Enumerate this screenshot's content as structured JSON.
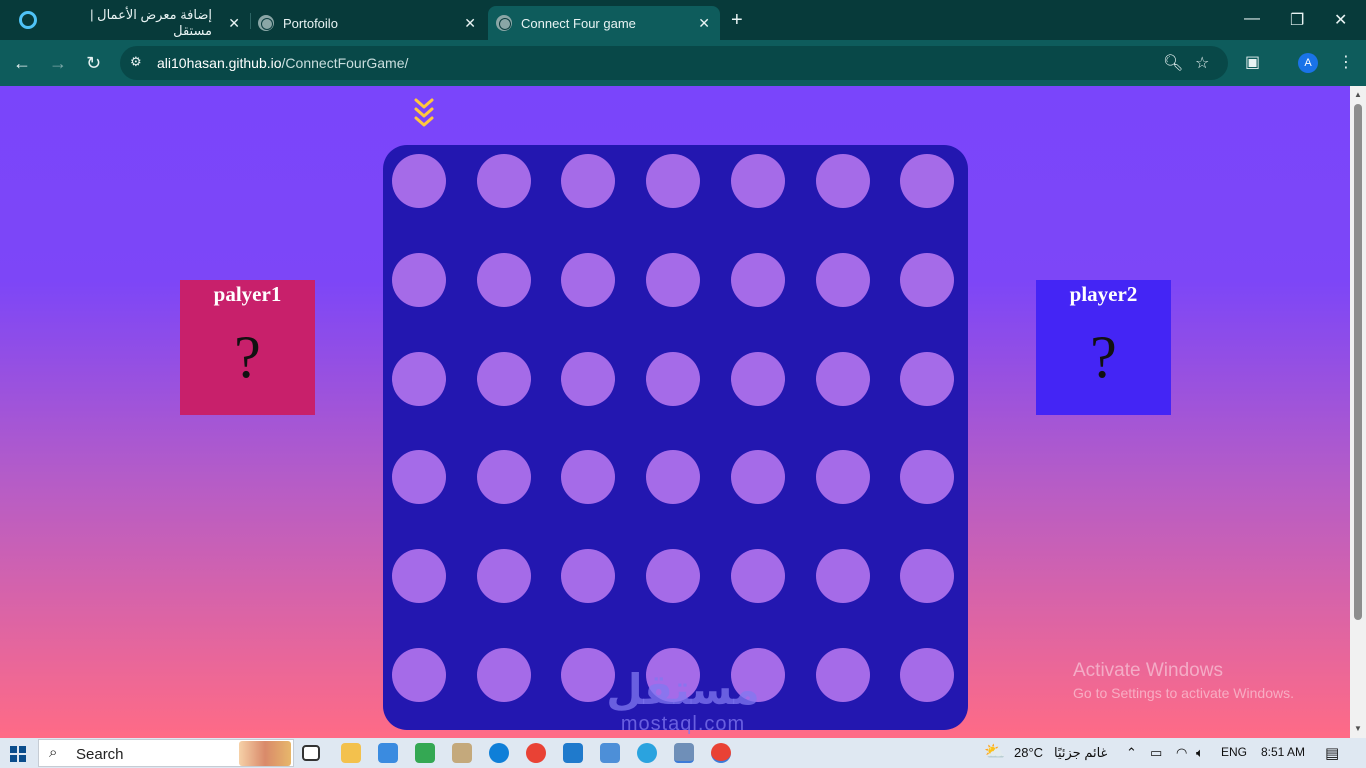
{
  "browser": {
    "tabs": [
      {
        "title": "إضافة معرض الأعمال | مستقل",
        "active": false
      },
      {
        "title": "Portofoilo",
        "active": false
      },
      {
        "title": "Connect Four game",
        "active": true
      }
    ],
    "new_tab_label": "+",
    "window_controls": {
      "minimize": "—",
      "restore": "❐",
      "close": "✕"
    },
    "address": {
      "host": "ali10hasan.github.io",
      "path": "/ConnectFourGame/"
    },
    "profile_initial": "A"
  },
  "game": {
    "rows": 6,
    "columns": 7,
    "board_color": "#2317b0",
    "empty_slot_color": "#a56be8",
    "drop_indicator_icon": "chevrons-down-icon",
    "player1": {
      "name": "palyer1",
      "value": "?",
      "color": "#c8206b"
    },
    "player2": {
      "name": "player2",
      "value": "?",
      "color": "#4425f5"
    }
  },
  "overlays": {
    "activate_windows_title": "Activate Windows",
    "activate_windows_subtitle": "Go to Settings to activate Windows.",
    "site_watermark_arabic": "مستقل",
    "site_watermark_latin": "mostaql.com"
  },
  "taskbar": {
    "search_label": "Search",
    "weather_temp": "28°C",
    "weather_text": "غائم جزئيًا",
    "language": "ENG",
    "time": "8:51 AM"
  }
}
